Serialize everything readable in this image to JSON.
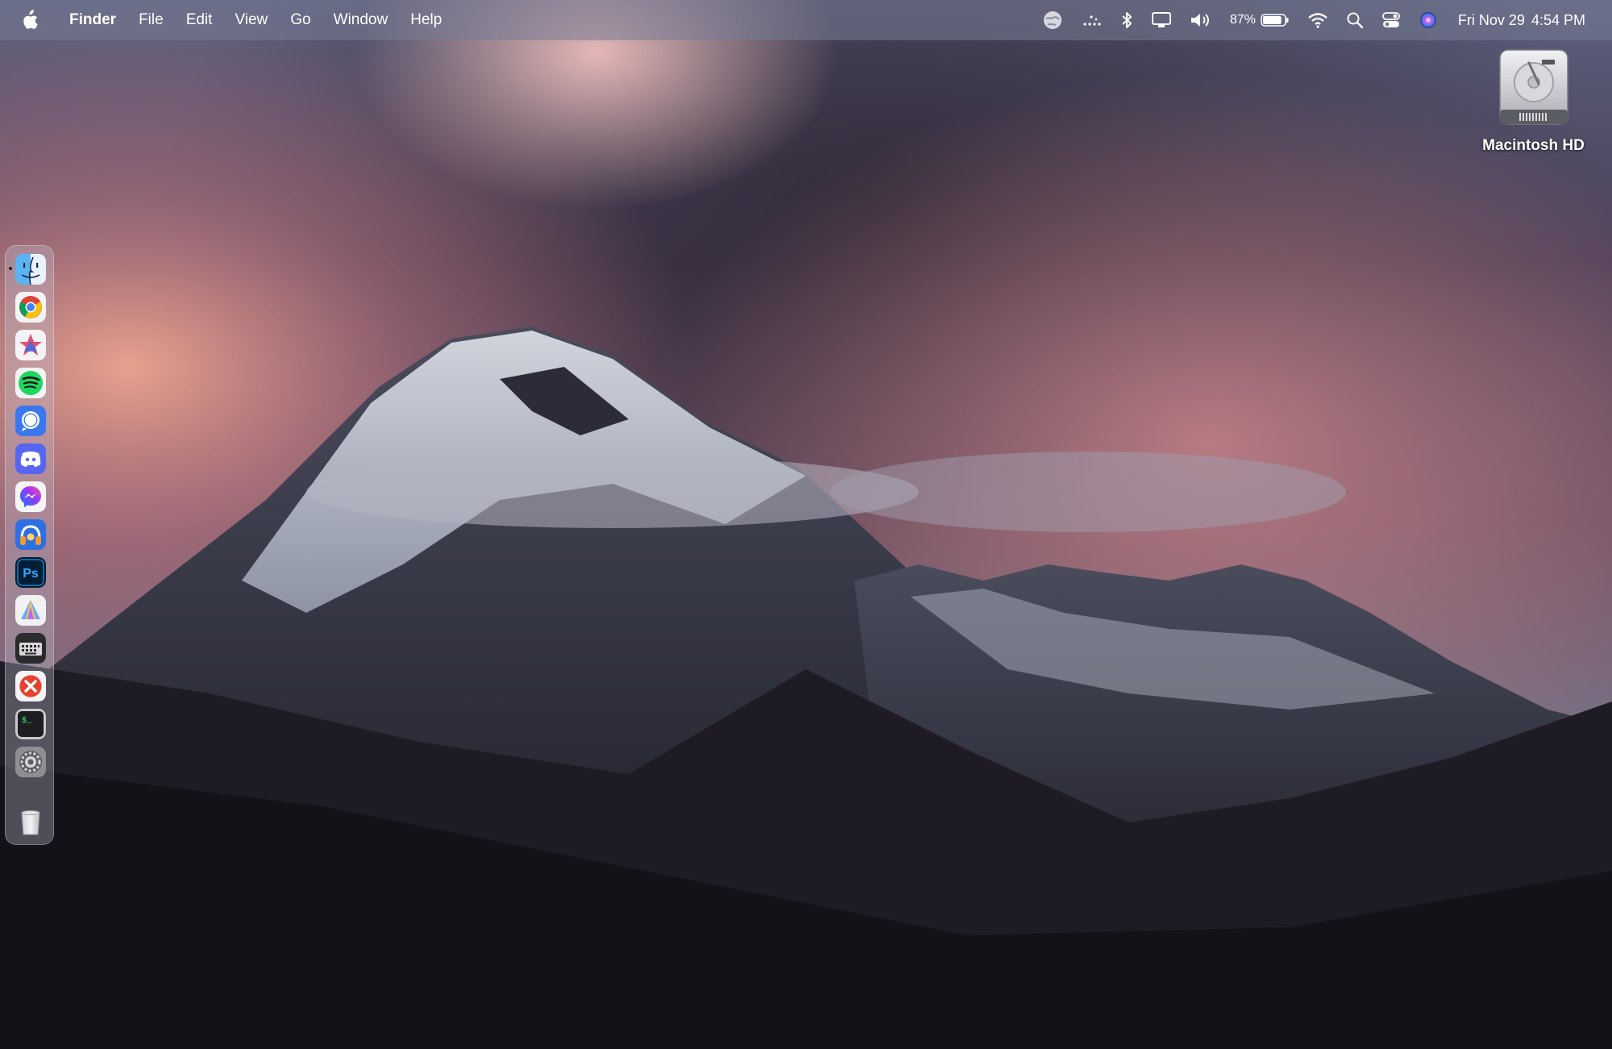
{
  "menubar": {
    "apple_icon": "apple-logo-icon",
    "app_name": "Finder",
    "menus": [
      "File",
      "Edit",
      "View",
      "Go",
      "Window",
      "Help"
    ],
    "status": {
      "battery_percent": "87%",
      "battery_level": 0.87,
      "date": "Fri Nov 29",
      "time": "4:54 PM"
    }
  },
  "desktop": {
    "drive_label": "Macintosh HD"
  },
  "dock": {
    "apps": [
      {
        "name": "Finder",
        "icon": "finder-icon",
        "running": true
      },
      {
        "name": "Google Chrome",
        "icon": "chrome-icon"
      },
      {
        "name": "Sketch-like App",
        "icon": "star-app-icon"
      },
      {
        "name": "Spotify",
        "icon": "spotify-icon"
      },
      {
        "name": "Signal",
        "icon": "signal-icon"
      },
      {
        "name": "Discord",
        "icon": "discord-icon"
      },
      {
        "name": "Messenger",
        "icon": "messenger-icon"
      },
      {
        "name": "Audio App",
        "icon": "headphones-app-icon"
      },
      {
        "name": "Photoshop",
        "icon": "photoshop-icon"
      },
      {
        "name": "Affinity-like App",
        "icon": "triangle-app-icon"
      },
      {
        "name": "Keyboard App",
        "icon": "keyboard-app-icon"
      },
      {
        "name": "Red App",
        "icon": "red-x-app-icon"
      },
      {
        "name": "Terminal",
        "icon": "terminal-icon"
      },
      {
        "name": "System Settings",
        "icon": "settings-gear-icon"
      },
      {
        "name": "Trash",
        "icon": "trash-icon"
      }
    ],
    "photoshop_glyph": "Ps",
    "terminal_glyph": "$_"
  },
  "colors": {
    "menubar_bg": "#7c7f99",
    "sky_pink": "#d48a8a",
    "mountain_dark": "#1c1a22"
  }
}
